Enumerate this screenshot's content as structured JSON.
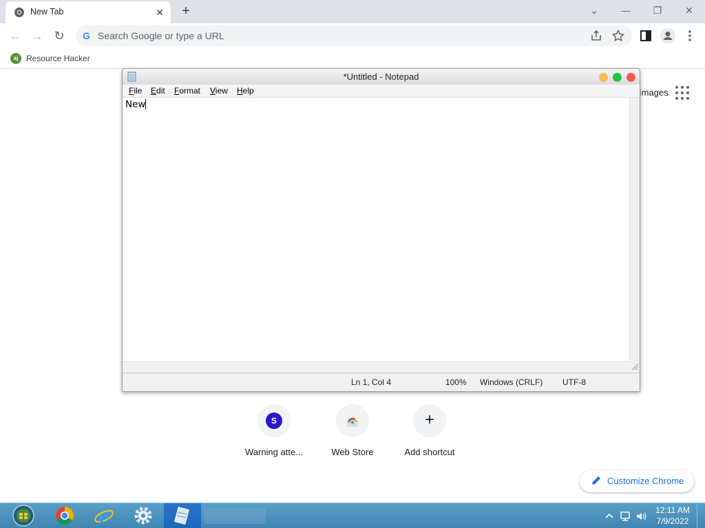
{
  "browser": {
    "tab": {
      "title": "New Tab",
      "close_glyph": "✕"
    },
    "new_tab_glyph": "+",
    "window_controls": {
      "tabsearch": "⌄",
      "minimize": "—",
      "restore": "❐",
      "close": "✕"
    },
    "nav": {
      "back": "←",
      "forward": "→",
      "reload": "↻"
    },
    "omnibox": {
      "placeholder": "Search Google or type a URL",
      "g_letter": "G"
    },
    "bookmarks": [
      {
        "label": "Resource Hacker",
        "icon_text": "aj"
      }
    ]
  },
  "ntp": {
    "images_label": "Images",
    "shortcuts": [
      {
        "label": "Warning atte...",
        "icon_letter": "S",
        "icon": "s-avatar-icon"
      },
      {
        "label": "Web Store",
        "icon": "chrome-webstore-icon"
      },
      {
        "label": "Add shortcut",
        "icon": "plus-icon",
        "glyph": "+"
      }
    ],
    "customize_label": "Customize Chrome"
  },
  "notepad": {
    "title": "*Untitled - Notepad",
    "menu": [
      "File",
      "Edit",
      "Format",
      "View",
      "Help"
    ],
    "content": "New",
    "status": {
      "position": "Ln 1, Col 4",
      "zoom": "100%",
      "line_endings": "Windows (CRLF)",
      "encoding": "UTF-8"
    }
  },
  "taskbar": {
    "apps": [
      "start-orb-icon",
      "chrome-icon",
      "internet-explorer-icon",
      "settings-gear-icon",
      "notepad-icon"
    ],
    "clock": {
      "time": "12:11 AM",
      "date": "7/9/2022"
    }
  },
  "colors": {
    "tabstrip": "#dee1e6",
    "accent_blue": "#1a73e8",
    "taskbar": "#4a92bd",
    "mac_close": "#ee5a52",
    "mac_min": "#f5bd4f",
    "mac_max": "#27c23f"
  }
}
